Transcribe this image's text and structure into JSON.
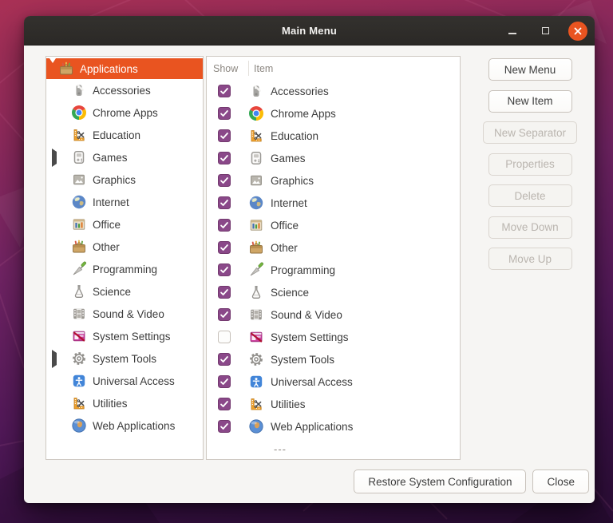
{
  "window": {
    "title": "Main Menu"
  },
  "titlebar": {
    "buttons": [
      "minimize-icon",
      "maximize-icon",
      "close-icon"
    ]
  },
  "tree": {
    "root": {
      "label": "Applications",
      "icon": "applications",
      "expanded": true,
      "selected": true
    },
    "items": [
      {
        "label": "Accessories",
        "icon": "accessories",
        "expandable": false
      },
      {
        "label": "Chrome Apps",
        "icon": "chrome",
        "expandable": false
      },
      {
        "label": "Education",
        "icon": "education",
        "expandable": false
      },
      {
        "label": "Games",
        "icon": "games",
        "expandable": true
      },
      {
        "label": "Graphics",
        "icon": "graphics",
        "expandable": false
      },
      {
        "label": "Internet",
        "icon": "internet",
        "expandable": false
      },
      {
        "label": "Office",
        "icon": "office",
        "expandable": false
      },
      {
        "label": "Other",
        "icon": "other",
        "expandable": false
      },
      {
        "label": "Programming",
        "icon": "programming",
        "expandable": false
      },
      {
        "label": "Science",
        "icon": "science",
        "expandable": false
      },
      {
        "label": "Sound & Video",
        "icon": "sound-video",
        "expandable": false
      },
      {
        "label": "System Settings",
        "icon": "system-settings",
        "expandable": false
      },
      {
        "label": "System Tools",
        "icon": "system-tools",
        "expandable": true
      },
      {
        "label": "Universal Access",
        "icon": "universal-access",
        "expandable": false
      },
      {
        "label": "Utilities",
        "icon": "education",
        "expandable": false
      },
      {
        "label": "Web Applications",
        "icon": "web-applications",
        "expandable": false
      }
    ]
  },
  "list": {
    "columns": [
      "Show",
      "Item"
    ],
    "items": [
      {
        "label": "Accessories",
        "icon": "accessories",
        "checked": true
      },
      {
        "label": "Chrome Apps",
        "icon": "chrome",
        "checked": true
      },
      {
        "label": "Education",
        "icon": "education",
        "checked": true
      },
      {
        "label": "Games",
        "icon": "games",
        "checked": true
      },
      {
        "label": "Graphics",
        "icon": "graphics",
        "checked": true
      },
      {
        "label": "Internet",
        "icon": "internet",
        "checked": true
      },
      {
        "label": "Office",
        "icon": "office",
        "checked": true
      },
      {
        "label": "Other",
        "icon": "other",
        "checked": true
      },
      {
        "label": "Programming",
        "icon": "programming",
        "checked": true
      },
      {
        "label": "Science",
        "icon": "science",
        "checked": true
      },
      {
        "label": "Sound & Video",
        "icon": "sound-video",
        "checked": true
      },
      {
        "label": "System Settings",
        "icon": "system-settings",
        "checked": false
      },
      {
        "label": "System Tools",
        "icon": "system-tools",
        "checked": true
      },
      {
        "label": "Universal Access",
        "icon": "universal-access",
        "checked": true
      },
      {
        "label": "Utilities",
        "icon": "education",
        "checked": true
      },
      {
        "label": "Web Applications",
        "icon": "web-applications",
        "checked": true
      }
    ],
    "separator_label": "---"
  },
  "side_buttons": [
    {
      "label": "New Menu",
      "enabled": true
    },
    {
      "label": "New Item",
      "enabled": true
    },
    {
      "label": "New Separator",
      "enabled": false
    },
    {
      "label": "Properties",
      "enabled": false
    },
    {
      "label": "Delete",
      "enabled": false
    },
    {
      "label": "Move Down",
      "enabled": false
    },
    {
      "label": "Move Up",
      "enabled": false
    }
  ],
  "bottom_buttons": [
    {
      "label": "Restore System Configuration"
    },
    {
      "label": "Close"
    }
  ],
  "colors": {
    "accent_orange": "#E95420",
    "checkbox_purple": "#8A4889",
    "titlebar": "#2C2A27",
    "window_bg": "#F6F5F3"
  }
}
